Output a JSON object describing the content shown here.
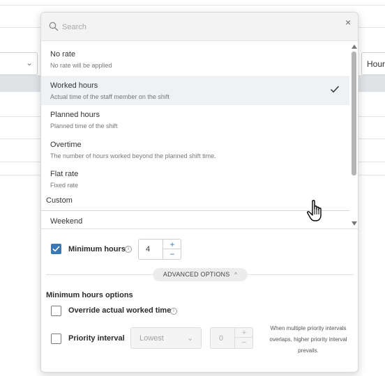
{
  "background": {
    "right_select_value": "Hour",
    "left_select_chevron_icon": "chevron-down-icon"
  },
  "popup": {
    "search": {
      "placeholder": "Search",
      "value": "",
      "icon": "search-icon"
    },
    "close_icon": "close-icon",
    "options": [
      {
        "title": "No rate",
        "subtitle": "No rate will be applied",
        "selected": false
      },
      {
        "title": "Worked hours",
        "subtitle": "Actual time of the staff member on the shift",
        "selected": true
      },
      {
        "title": "Planned hours",
        "subtitle": "Planned time of the shift",
        "selected": false
      },
      {
        "title": "Overtime",
        "subtitle": "The number of hours worked beyond the planned shift time.",
        "selected": false
      },
      {
        "title": "Flat rate",
        "subtitle": "Fixed rate",
        "selected": false
      }
    ],
    "custom_group_label": "Custom",
    "custom_options": [
      {
        "title": "Weekend"
      }
    ]
  },
  "form": {
    "minimum_hours": {
      "label": "Minimum hours",
      "checked": true,
      "value": "4",
      "plus": "+",
      "minus": "−"
    },
    "advanced_options_label": "ADVANCED OPTIONS",
    "minimum_hours_options_title": "Minimum hours options",
    "override_actual": {
      "label": "Override actual worked time",
      "checked": false
    },
    "priority_interval": {
      "label": "Priority interval",
      "checked": false,
      "select_value": "Lowest",
      "stepper_value": "0",
      "plus": "+",
      "minus": "−",
      "help_text": "When multiple priority intervals overlaps, higher priority interval prevails."
    }
  },
  "colors": {
    "accent": "#3a7ab4",
    "selected_row_bg": "#eef2f5",
    "header_band": "#dfe3e6"
  }
}
